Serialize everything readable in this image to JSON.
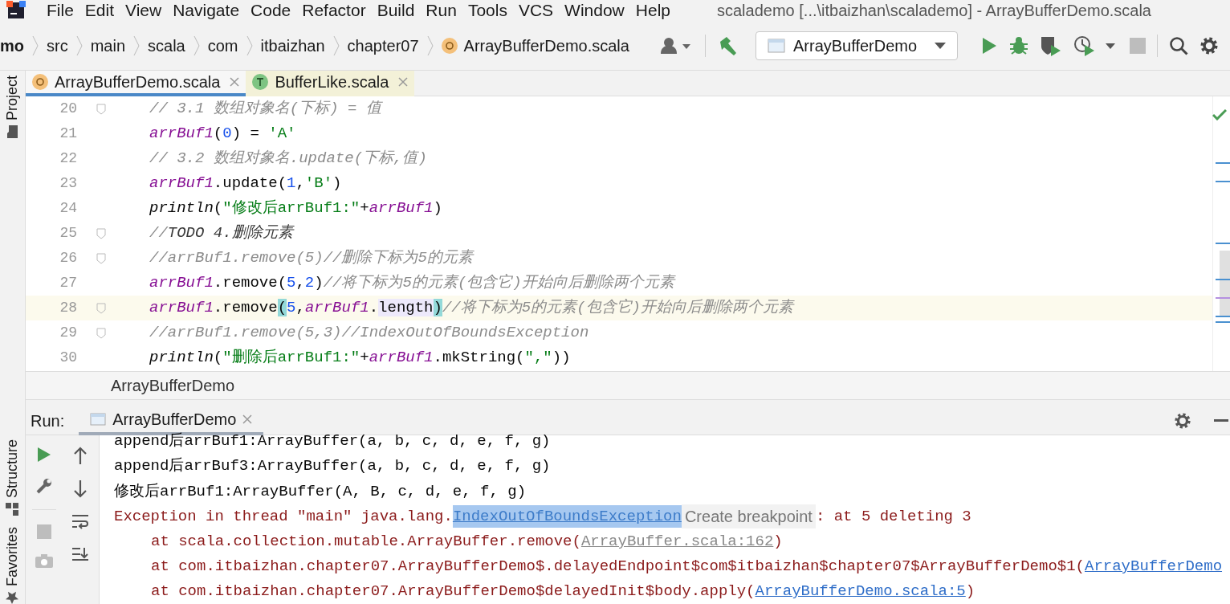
{
  "menu": [
    "File",
    "Edit",
    "View",
    "Navigate",
    "Code",
    "Refactor",
    "Build",
    "Run",
    "Tools",
    "VCS",
    "Window",
    "Help"
  ],
  "window": {
    "title": "scalademo [...\\itbaizhan\\scalademo] - ArrayBufferDemo.scala"
  },
  "breadcrumbs": [
    {
      "label": "mo",
      "kind": "project"
    },
    {
      "label": "src",
      "kind": "folder"
    },
    {
      "label": "main",
      "kind": "folder"
    },
    {
      "label": "scala",
      "kind": "folder"
    },
    {
      "label": "com",
      "kind": "folder"
    },
    {
      "label": "itbaizhan",
      "kind": "folder"
    },
    {
      "label": "chapter07",
      "kind": "folder"
    },
    {
      "label": "ArrayBufferDemo.scala",
      "kind": "object"
    }
  ],
  "run_config": "ArrayBufferDemo",
  "side_tabs_left": [
    "Project",
    "Structure",
    "Favorites"
  ],
  "editor_tabs": [
    {
      "label": "ArrayBufferDemo.scala",
      "kind": "object",
      "selected": true
    },
    {
      "label": "BufferLike.scala",
      "kind": "trait",
      "selected": false
    }
  ],
  "code": [
    {
      "number": "20",
      "fold": true,
      "current": false,
      "tokens": [
        {
          "kind": "comment",
          "text": "// 3.1 数组对象名(下标) = 值"
        }
      ]
    },
    {
      "number": "21",
      "fold": false,
      "current": false,
      "tokens": [
        {
          "kind": "var",
          "text": "arrBuf1"
        },
        {
          "kind": "plain",
          "text": "("
        },
        {
          "kind": "num",
          "text": "0"
        },
        {
          "kind": "plain",
          "text": ") = "
        },
        {
          "kind": "str",
          "text": "'A'"
        }
      ]
    },
    {
      "number": "22",
      "fold": false,
      "current": false,
      "tokens": [
        {
          "kind": "comment",
          "text": "// 3.2 数组对象名.update(下标,值)"
        }
      ]
    },
    {
      "number": "23",
      "fold": false,
      "current": false,
      "tokens": [
        {
          "kind": "var",
          "text": "arrBuf1"
        },
        {
          "kind": "plain",
          "text": ".update("
        },
        {
          "kind": "num",
          "text": "1"
        },
        {
          "kind": "plain",
          "text": ","
        },
        {
          "kind": "str",
          "text": "'B'"
        },
        {
          "kind": "plain",
          "text": ")"
        }
      ]
    },
    {
      "number": "24",
      "fold": false,
      "current": false,
      "tokens": [
        {
          "kind": "fn",
          "text": "println"
        },
        {
          "kind": "plain",
          "text": "("
        },
        {
          "kind": "str",
          "text": "\"修改后arrBuf1:\""
        },
        {
          "kind": "plain",
          "text": "+"
        },
        {
          "kind": "var",
          "text": "arrBuf1"
        },
        {
          "kind": "plain",
          "text": ")"
        }
      ]
    },
    {
      "number": "25",
      "fold": true,
      "current": false,
      "tokens": [
        {
          "kind": "comment",
          "text": "//"
        },
        {
          "kind": "todo",
          "text": "TODO 4.删除元素"
        }
      ]
    },
    {
      "number": "26",
      "fold": true,
      "current": false,
      "tokens": [
        {
          "kind": "comment",
          "text": "//arrBuf1.remove(5)//删除下标为5的元素"
        }
      ]
    },
    {
      "number": "27",
      "fold": false,
      "current": false,
      "tokens": [
        {
          "kind": "var",
          "text": "arrBuf1"
        },
        {
          "kind": "plain",
          "text": ".remove("
        },
        {
          "kind": "num",
          "text": "5"
        },
        {
          "kind": "plain",
          "text": ","
        },
        {
          "kind": "num",
          "text": "2"
        },
        {
          "kind": "plain",
          "text": ")"
        },
        {
          "kind": "comment",
          "text": "//将下标为5的元素(包含它)开始向后删除两个元素"
        }
      ]
    },
    {
      "number": "28",
      "fold": true,
      "current": true,
      "tokens": [
        {
          "kind": "var",
          "text": "arrBuf1"
        },
        {
          "kind": "plain",
          "text": ".remove"
        },
        {
          "kind": "brace",
          "text": "("
        },
        {
          "kind": "num",
          "text": "5"
        },
        {
          "kind": "plain",
          "text": ","
        },
        {
          "kind": "var",
          "text": "arrBuf1"
        },
        {
          "kind": "plain",
          "text": "."
        },
        {
          "kind": "usage",
          "text": "length"
        },
        {
          "kind": "brace",
          "text": ")"
        },
        {
          "kind": "comment",
          "text": "//将下标为5的元素(包含它)开始向后删除两个元素"
        }
      ]
    },
    {
      "number": "29",
      "fold": true,
      "current": false,
      "tokens": [
        {
          "kind": "comment",
          "text": "//arrBuf1.remove(5,3)//IndexOutOfBoundsException"
        }
      ]
    },
    {
      "number": "30",
      "fold": false,
      "current": false,
      "tokens": [
        {
          "kind": "fn",
          "text": "println"
        },
        {
          "kind": "plain",
          "text": "("
        },
        {
          "kind": "str",
          "text": "\"删除后arrBuf1:\""
        },
        {
          "kind": "plain",
          "text": "+"
        },
        {
          "kind": "var",
          "text": "arrBuf1"
        },
        {
          "kind": "plain",
          "text": ".mkString("
        },
        {
          "kind": "str",
          "text": "\",\""
        },
        {
          "kind": "plain",
          "text": "))"
        }
      ]
    }
  ],
  "editor_breadcrumb": "ArrayBufferDemo",
  "run_panel": {
    "label": "Run:",
    "tab": "ArrayBufferDemo"
  },
  "console": [
    {
      "indent": false,
      "segments": [
        {
          "kind": "out",
          "text": "append后arrBuf1:ArrayBuffer(a, b, c, d, e, f, g)"
        }
      ]
    },
    {
      "indent": false,
      "segments": [
        {
          "kind": "out",
          "text": "append后arrBuf3:ArrayBuffer(a, b, c, d, e, f, g)"
        }
      ]
    },
    {
      "indent": false,
      "segments": [
        {
          "kind": "out",
          "text": "修改后arrBuf1:ArrayBuffer(A, B, c, d, e, f, g)"
        }
      ]
    },
    {
      "indent": false,
      "segments": [
        {
          "kind": "err",
          "text": "Exception in thread \"main\" java.lang."
        },
        {
          "kind": "selected_link",
          "text": "IndexOutOfBoundsException"
        },
        {
          "kind": "tooltip",
          "text": "Create breakpoint"
        },
        {
          "kind": "err",
          "text": ": at 5 deleting 3"
        }
      ]
    },
    {
      "indent": true,
      "segments": [
        {
          "kind": "err",
          "text": "at scala.collection.mutable.ArrayBuffer.remove("
        },
        {
          "kind": "lib_link",
          "text": "ArrayBuffer.scala:162"
        },
        {
          "kind": "err",
          "text": ")"
        }
      ]
    },
    {
      "indent": true,
      "segments": [
        {
          "kind": "err",
          "text": "at com.itbaizhan.chapter07.ArrayBufferDemo$.delayedEndpoint$com$itbaizhan$chapter07$ArrayBufferDemo$1("
        },
        {
          "kind": "link",
          "text": "ArrayBufferDemo"
        }
      ]
    },
    {
      "indent": true,
      "segments": [
        {
          "kind": "err",
          "text": "at com.itbaizhan.chapter07.ArrayBufferDemo$delayedInit$body.apply("
        },
        {
          "kind": "link",
          "text": "ArrayBufferDemo.scala:5"
        },
        {
          "kind": "err",
          "text": ")"
        }
      ]
    }
  ]
}
